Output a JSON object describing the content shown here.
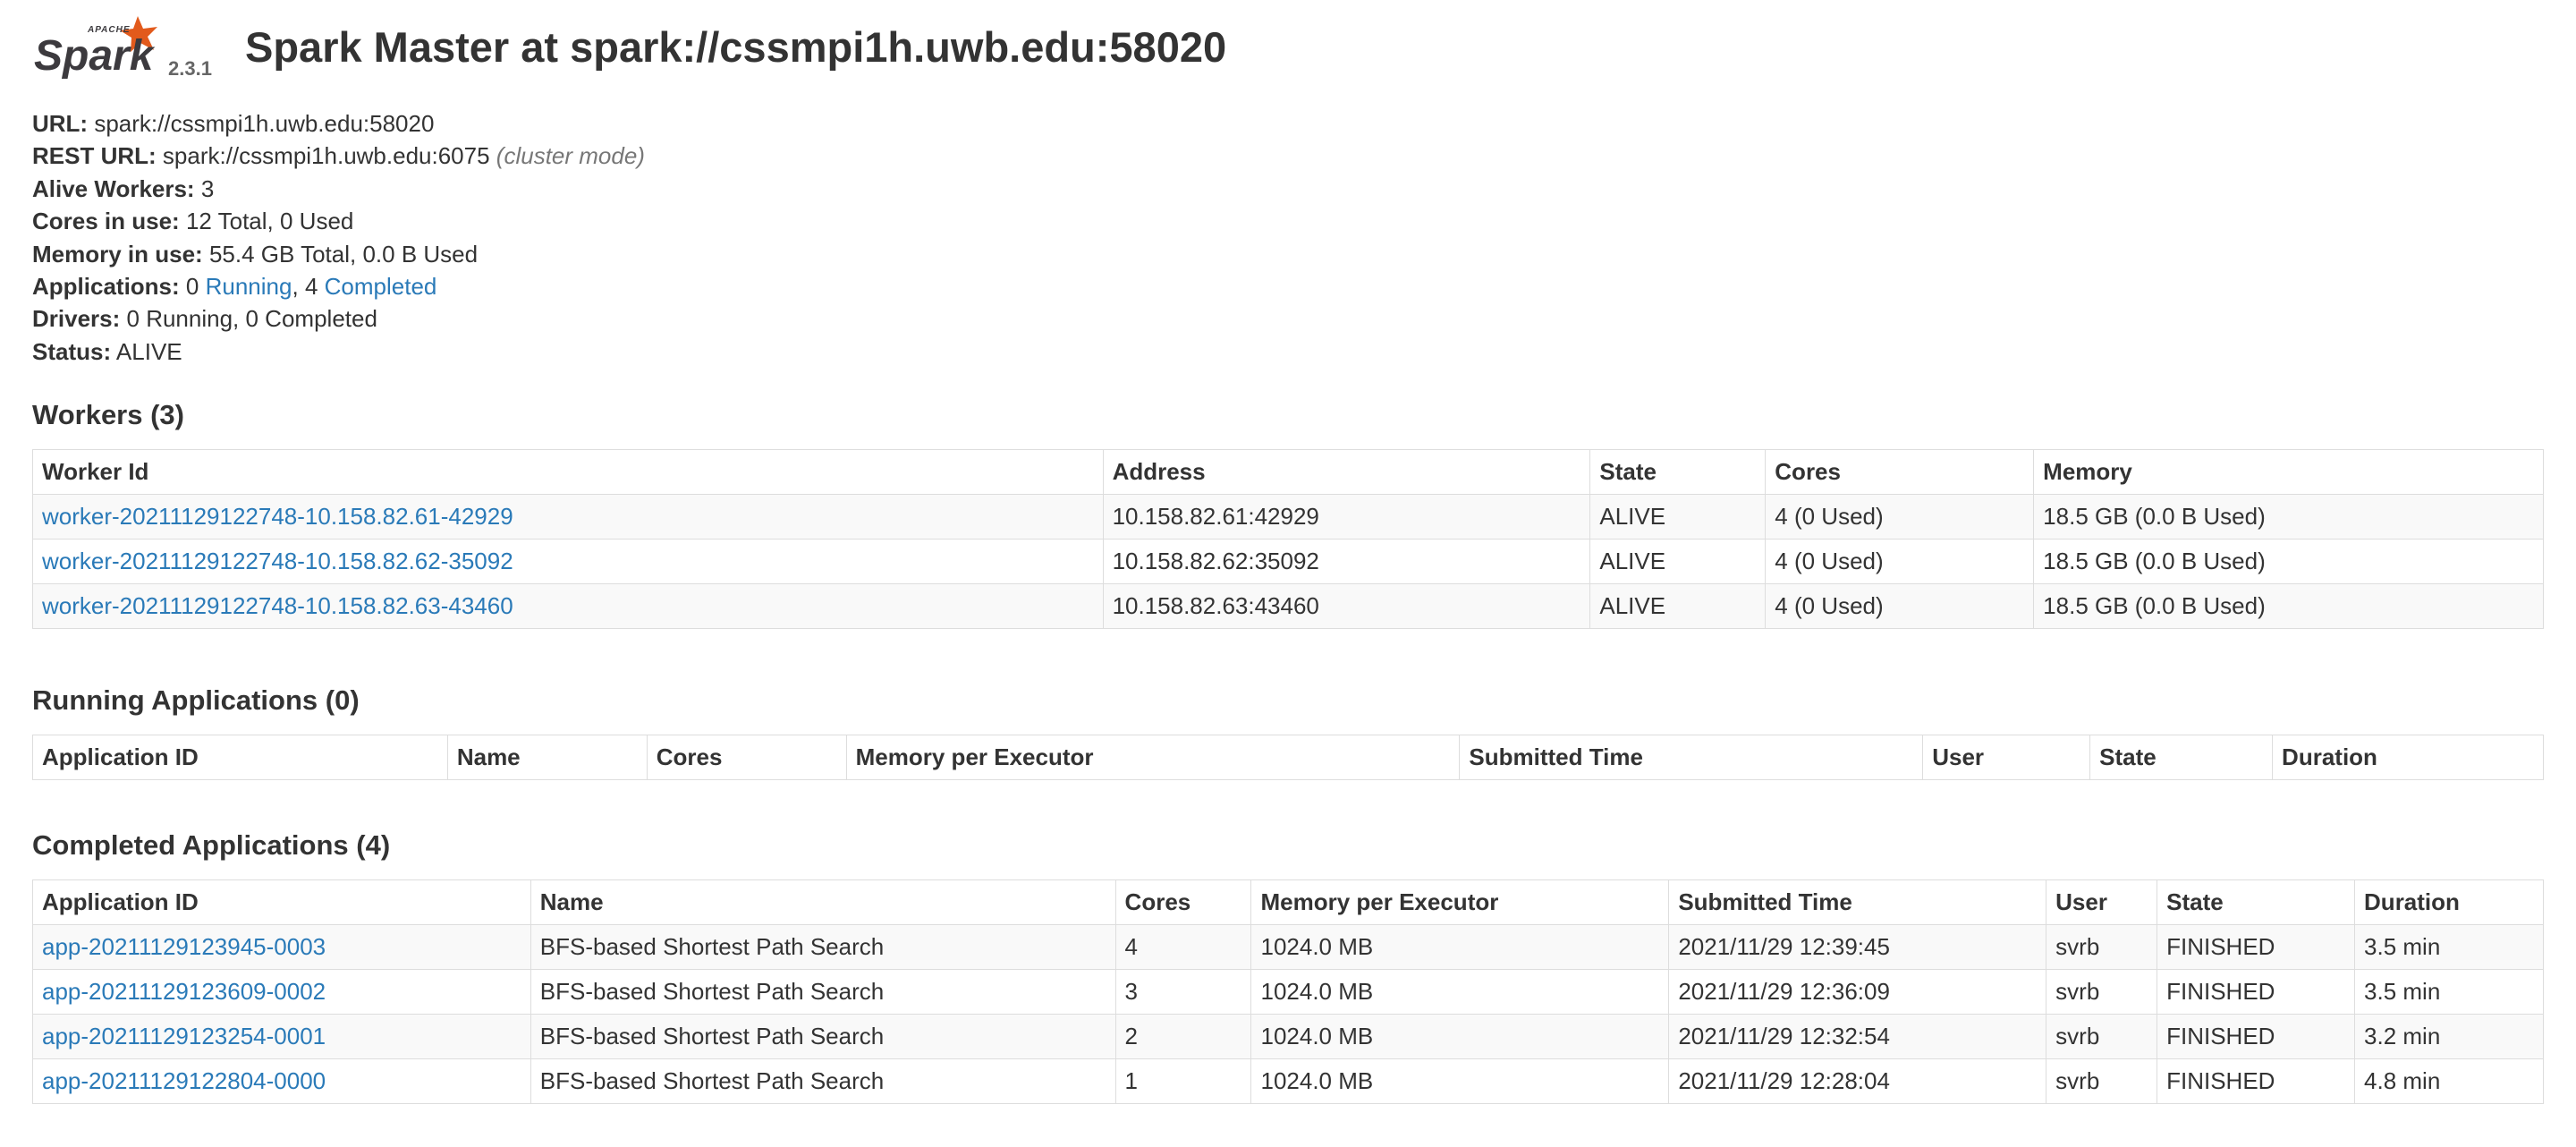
{
  "header": {
    "logo_text": "Spark",
    "logo_small_text": "APACHE",
    "version": "2.3.1",
    "title": "Spark Master at spark://cssmpi1h.uwb.edu:58020"
  },
  "summary": {
    "url_label": "URL:",
    "url_value": "spark://cssmpi1h.uwb.edu:58020",
    "rest_url_label": "REST URL:",
    "rest_url_value": "spark://cssmpi1h.uwb.edu:6075",
    "rest_url_mode": "(cluster mode)",
    "alive_workers_label": "Alive Workers:",
    "alive_workers_value": "3",
    "cores_label": "Cores in use:",
    "cores_value": "12 Total, 0 Used",
    "memory_label": "Memory in use:",
    "memory_value": "55.4 GB Total, 0.0 B Used",
    "applications_label": "Applications:",
    "applications_running_count": "0",
    "applications_running_link": "Running",
    "applications_sep": ",",
    "applications_completed_count": "4",
    "applications_completed_link": "Completed",
    "drivers_label": "Drivers:",
    "drivers_value": "0 Running, 0 Completed",
    "status_label": "Status:",
    "status_value": "ALIVE"
  },
  "workers": {
    "title": "Workers (3)",
    "columns": [
      "Worker Id",
      "Address",
      "State",
      "Cores",
      "Memory"
    ],
    "rows": [
      [
        "worker-20211129122748-10.158.82.61-42929",
        "10.158.82.61:42929",
        "ALIVE",
        "4 (0 Used)",
        "18.5 GB (0.0 B Used)"
      ],
      [
        "worker-20211129122748-10.158.82.62-35092",
        "10.158.82.62:35092",
        "ALIVE",
        "4 (0 Used)",
        "18.5 GB (0.0 B Used)"
      ],
      [
        "worker-20211129122748-10.158.82.63-43460",
        "10.158.82.63:43460",
        "ALIVE",
        "4 (0 Used)",
        "18.5 GB (0.0 B Used)"
      ]
    ]
  },
  "running_apps": {
    "title": "Running Applications (0)",
    "columns": [
      "Application ID",
      "Name",
      "Cores",
      "Memory per Executor",
      "Submitted Time",
      "User",
      "State",
      "Duration"
    ]
  },
  "completed_apps": {
    "title": "Completed Applications (4)",
    "columns": [
      "Application ID",
      "Name",
      "Cores",
      "Memory per Executor",
      "Submitted Time",
      "User",
      "State",
      "Duration"
    ],
    "rows": [
      [
        "app-20211129123945-0003",
        "BFS-based Shortest Path Search",
        "4",
        "1024.0 MB",
        "2021/11/29 12:39:45",
        "svrb",
        "FINISHED",
        "3.5 min"
      ],
      [
        "app-20211129123609-0002",
        "BFS-based Shortest Path Search",
        "3",
        "1024.0 MB",
        "2021/11/29 12:36:09",
        "svrb",
        "FINISHED",
        "3.5 min"
      ],
      [
        "app-20211129123254-0001",
        "BFS-based Shortest Path Search",
        "2",
        "1024.0 MB",
        "2021/11/29 12:32:54",
        "svrb",
        "FINISHED",
        "3.2 min"
      ],
      [
        "app-20211129122804-0000",
        "BFS-based Shortest Path Search",
        "1",
        "1024.0 MB",
        "2021/11/29 12:28:04",
        "svrb",
        "FINISHED",
        "4.8 min"
      ]
    ]
  },
  "colors": {
    "link": "#2a7ab8",
    "text": "#333333",
    "logo_orange": "#e25a1c",
    "logo_dark": "#3c3a3e",
    "border": "#dddddd",
    "stripe": "#f9f9f9"
  }
}
